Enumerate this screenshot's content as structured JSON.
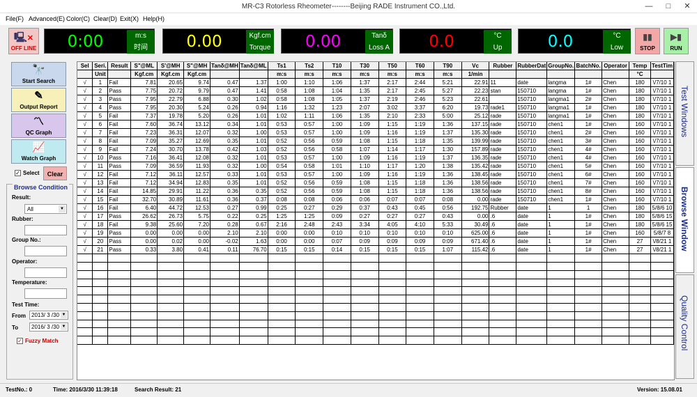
{
  "window": {
    "title": "MR-C3 Rotorless Rheometer--------Beijing RADE Instrument CO.,Ltd.",
    "minimize": "—",
    "maximize": "□",
    "close": "✕"
  },
  "menu": [
    "File(F)",
    "Advanced(E)",
    "Color(C)",
    "Clear(D)",
    "Exit(X)",
    "Help(H)"
  ],
  "toolbar": {
    "offline": "OFF LINE",
    "displays": [
      {
        "value": "0:00",
        "unit1": "m:s",
        "unit2": "时间",
        "color": "#00ff00"
      },
      {
        "value": "0.00",
        "unit1": "Kgf.cm",
        "unit2": "Torque",
        "color": "#ffff00"
      },
      {
        "value": "0.00",
        "unit1": "Tanδ",
        "unit2": "Loss A",
        "color": "#ff00ff"
      },
      {
        "value": "0.0",
        "unit1": "°C",
        "unit2": "Up",
        "color": "#ff0000"
      },
      {
        "value": "0.0",
        "unit1": "°C",
        "unit2": "Low",
        "color": "#00ffff"
      }
    ],
    "stop": "STOP",
    "run": "RUN"
  },
  "left": {
    "start_search": "Start Search",
    "output_report": "Output Report",
    "qc_graph": "QC Graph",
    "watch_graph": "Watch Graph",
    "select": "Select",
    "clear": "Clear",
    "browse_condition": "Browse Condition",
    "result_label": "Result:",
    "result_value": "All",
    "rubber_label": "Rubber:",
    "group_label": "Group No.:",
    "operator_label": "Operator:",
    "temperature_label": "Temperature:",
    "test_time_label": "Test Time:",
    "from_label": "From",
    "from_value": "2013/ 3 /30",
    "to_label": "To",
    "to_value": "2016/ 3 /30",
    "fuzzy": "Fuzzy Match"
  },
  "table": {
    "headers1": [
      "Sel",
      "Seri.",
      "Result",
      "S\"@ML",
      "S'@MH",
      "S\"@MH",
      "Tanδ@MH",
      "Tanδ@ML",
      "Ts1",
      "Ts2",
      "T10",
      "T30",
      "T50",
      "T60",
      "T90",
      "Vc",
      "Rubber",
      "RubberDat",
      "GroupNo.",
      "BatchNo.",
      "Operator",
      "Temp",
      "TestTim"
    ],
    "headers2": [
      "",
      "Unit",
      "",
      "Kgf.cm",
      "Kgf.cm",
      "Kgf.cm",
      "",
      "",
      "m:s",
      "m:s",
      "m:s",
      "m:s",
      "m:s",
      "m:s",
      "m:s",
      "1/min",
      "",
      "",
      "",
      "",
      "",
      "°C",
      ""
    ],
    "rows": [
      [
        "√",
        "1",
        "Fail",
        "7.81",
        "20.65",
        "9.74",
        "0.47",
        "1.37",
        "1:00",
        "1:10",
        "1:06",
        "1:37",
        "2:17",
        "2:44",
        "5:21",
        "22.91",
        "11",
        "date",
        "langma",
        "1#",
        "Chen",
        "180",
        "\\/7/10 1"
      ],
      [
        "√",
        "2",
        "Pass",
        "7.75",
        "20.72",
        "9.79",
        "0.47",
        "1.41",
        "0:58",
        "1:08",
        "1:04",
        "1:35",
        "2:17",
        "2:45",
        "5:27",
        "22.23",
        "stan",
        "150710",
        "langma",
        "1#",
        "Chen",
        "180",
        "\\/7/10 1"
      ],
      [
        "√",
        "3",
        "Pass",
        "7.95",
        "22.79",
        "6.88",
        "0.30",
        "1.02",
        "0:58",
        "1:08",
        "1:05",
        "1:37",
        "2:19",
        "2:46",
        "5:23",
        "22.61",
        "",
        "150710",
        "langma1",
        "2#",
        "Chen",
        "180",
        "\\/7/10 1"
      ],
      [
        "√",
        "4",
        "Pass",
        "7.95",
        "20.30",
        "5.24",
        "0.26",
        "0.94",
        "1:16",
        "1:32",
        "1:23",
        "2:07",
        "3:02",
        "3:37",
        "6:20",
        "19.73",
        "rade1",
        "150710",
        "langma1",
        "1#",
        "Chen",
        "180",
        "\\/7/10 1"
      ],
      [
        "√",
        "5",
        "Fail",
        "7.37",
        "19.78",
        "5.20",
        "0.26",
        "1.01",
        "1:02",
        "1:11",
        "1:06",
        "1:35",
        "2:10",
        "2:33",
        "5:00",
        "25.12",
        "rade",
        "150710",
        "langma1",
        "1#",
        "Chen",
        "180",
        "\\/7/10 1"
      ],
      [
        "√",
        "6",
        "Fail",
        "7.60",
        "36.74",
        "13.12",
        "0.34",
        "1.01",
        "0:53",
        "0:57",
        "1:00",
        "1:09",
        "1:15",
        "1:19",
        "1:36",
        "137.15",
        "rade",
        "150710",
        "chen1",
        "1#",
        "Chen",
        "160",
        "\\/7/10 1"
      ],
      [
        "√",
        "7",
        "Fail",
        "7.23",
        "36.31",
        "12.07",
        "0.32",
        "1.00",
        "0:53",
        "0:57",
        "1:00",
        "1:09",
        "1:16",
        "1:19",
        "1:37",
        "135.30",
        "rade",
        "150710",
        "chen1",
        "2#",
        "Chen",
        "160",
        "\\/7/10 1"
      ],
      [
        "√",
        "8",
        "Fail",
        "7.09",
        "35.27",
        "12.69",
        "0.35",
        "1.01",
        "0:52",
        "0:56",
        "0:59",
        "1:08",
        "1:15",
        "1:18",
        "1:35",
        "139.99",
        "rade",
        "150710",
        "chen1",
        "3#",
        "Chen",
        "160",
        "\\/7/10 1"
      ],
      [
        "√",
        "9",
        "Fail",
        "7.24",
        "30.70",
        "13.78",
        "0.42",
        "1.03",
        "0:52",
        "0:56",
        "0:58",
        "1:07",
        "1:14",
        "1:17",
        "1:30",
        "157.89",
        "rade",
        "150710",
        "chen1",
        "4#",
        "Chen",
        "160",
        "\\/7/10 1"
      ],
      [
        "√",
        "10",
        "Pass",
        "7.16",
        "36.41",
        "12.08",
        "0.32",
        "1.01",
        "0:53",
        "0:57",
        "1:00",
        "1:09",
        "1:16",
        "1:19",
        "1:37",
        "136.35",
        "rade",
        "150710",
        "chen1",
        "4#",
        "Chen",
        "160",
        "\\/7/10 1"
      ],
      [
        "√",
        "11",
        "Pass",
        "7.09",
        "36.59",
        "11.93",
        "0.32",
        "1.00",
        "0:54",
        "0:58",
        "1:01",
        "1:10",
        "1:17",
        "1:20",
        "1:38",
        "135.42",
        "rade",
        "150710",
        "chen1",
        "5#",
        "Chen",
        "160",
        "\\/7/10 1"
      ],
      [
        "√",
        "12",
        "Fail",
        "7.12",
        "36.11",
        "12.57",
        "0.33",
        "1.01",
        "0:53",
        "0:57",
        "1:00",
        "1:09",
        "1:16",
        "1:19",
        "1:36",
        "138.45",
        "rade",
        "150710",
        "chen1",
        "6#",
        "Chen",
        "160",
        "\\/7/10 1"
      ],
      [
        "√",
        "13",
        "Fail",
        "7.12",
        "34.94",
        "12.83",
        "0.35",
        "1.01",
        "0:52",
        "0:56",
        "0:59",
        "1:08",
        "1:15",
        "1:18",
        "1:36",
        "138.56",
        "rade",
        "150710",
        "chen1",
        "7#",
        "Chen",
        "160",
        "\\/7/10 1"
      ],
      [
        "√",
        "14",
        "Fail",
        "14.85",
        "29.91",
        "11.22",
        "0.36",
        "0.35",
        "0:52",
        "0:56",
        "0:59",
        "1:08",
        "1:15",
        "1:18",
        "1:36",
        "138.56",
        "rade",
        "150710",
        "chen1",
        "8#",
        "Chen",
        "160",
        "\\/7/10 1"
      ],
      [
        "√",
        "15",
        "Fail",
        "32.70",
        "30.89",
        "11.61",
        "0.36",
        "0.37",
        "0:08",
        "0:08",
        "0:06",
        "0:06",
        "0:07",
        "0:07",
        "0:08",
        "0.00",
        "rade",
        "150710",
        "chen1",
        "1#",
        "Chen",
        "160",
        "\\/7/10 1"
      ],
      [
        "√",
        "16",
        "Fail",
        "6.40",
        "44.72",
        "12.53",
        "0.27",
        "0.99",
        "0:25",
        "0:27",
        "0:29",
        "0:37",
        "0:43",
        "0:45",
        "0:56",
        "192.75",
        "Rubber",
        "date",
        "1",
        "1",
        "Chen",
        "180",
        "5/8/6 10"
      ],
      [
        "√",
        "17",
        "Pass",
        "26.62",
        "26.73",
        "5.75",
        "0.22",
        "0.25",
        "1:25",
        "1:25",
        "0:09",
        "0:27",
        "0:27",
        "0:27",
        "0:43",
        "0.00",
        ".6",
        "date",
        "1",
        "1#",
        "Chen",
        "180",
        "5/8/6 15"
      ],
      [
        "√",
        "18",
        "Fail",
        "9.38",
        "25.60",
        "7.20",
        "0.28",
        "0.67",
        "2:16",
        "2:48",
        "2:43",
        "3:34",
        "4:05",
        "4:10",
        "5:33",
        "30.49",
        ".6",
        "date",
        "1",
        "1#",
        "Chen",
        "180",
        "5/8/6 15"
      ],
      [
        "√",
        "19",
        "Pass",
        "0.00",
        "0.00",
        "0.00",
        "2.10",
        "2.10",
        "0:00",
        "0:00",
        "0:10",
        "0:10",
        "0:10",
        "0:10",
        "0:10",
        "625.00",
        ".6",
        "date",
        "1",
        "1#",
        "Chen",
        "160",
        "5/8/7 8"
      ],
      [
        "√",
        "20",
        "Pass",
        "0.00",
        "0.02",
        "0.00",
        "-0.02",
        "1.63",
        "0:00",
        "0:00",
        "0:07",
        "0:09",
        "0:09",
        "0:09",
        "0:09",
        "671.40",
        ".6",
        "date",
        "1",
        "1#",
        "Chen",
        "27",
        "\\/8/21 1"
      ],
      [
        "√",
        "21",
        "Pass",
        "0.33",
        "3.80",
        "0.41",
        "0.11",
        "76.70",
        "0:15",
        "0:15",
        "0:14",
        "0:15",
        "0:15",
        "0:15",
        "1:07",
        "115.42",
        ".6",
        "date",
        "1",
        "1#",
        "Chen",
        "27",
        "\\/8/21 1"
      ]
    ]
  },
  "tabs": {
    "test": "Test Windows",
    "browse": "Browse Window",
    "quality": "Quality Control"
  },
  "status": {
    "test_no": "TestNo.: 0",
    "time": "Time: 2016/3/30 11:39:18",
    "search_result": "Search Result: 21",
    "version": "Version: 15.08.01"
  }
}
